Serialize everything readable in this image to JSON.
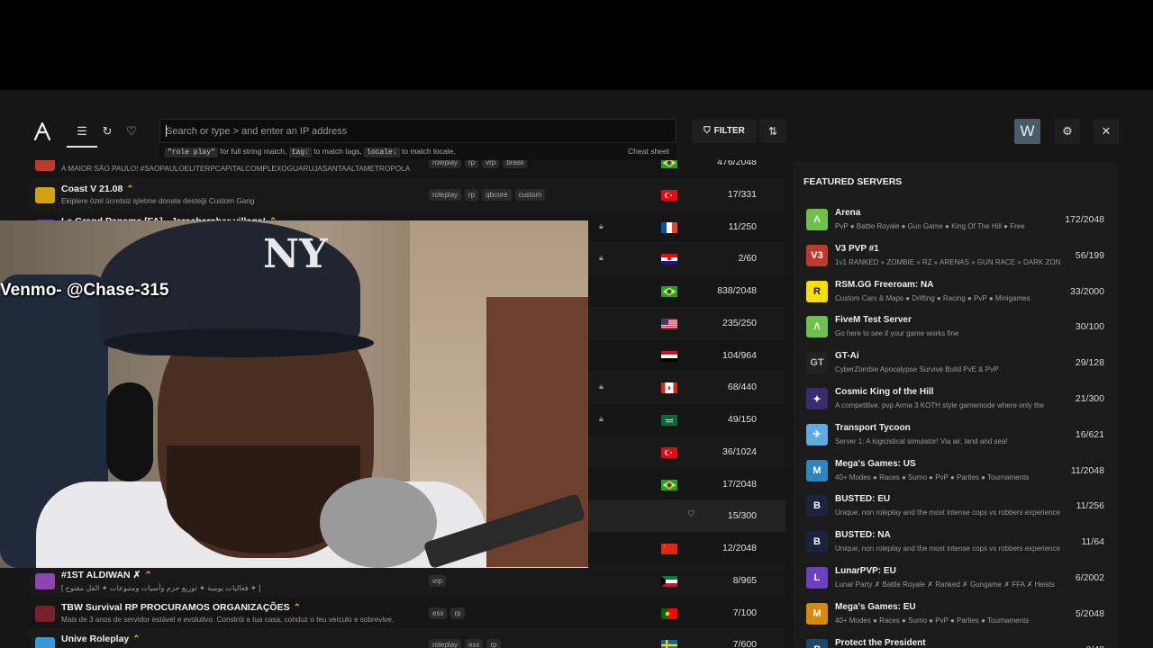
{
  "topbar": {
    "search_placeholder": "Search or type > and enter an IP address",
    "hint_code1": "\"role play\"",
    "hint_text1": " for full string match,",
    "hint_code2": "tag:",
    "hint_text2": " to match tags,",
    "hint_code3": "locale:",
    "hint_text3": " to match locale,",
    "cheat_sheet": "Cheat sheet",
    "filter_label": "FILTER",
    "avatar_initial": "W"
  },
  "servers": [
    {
      "name": "",
      "desc": "A MAIOR SÃO PAULO! #SAOPAULOELITERPCAPITALCOMPLEXOGUARUJASANTAALTAMETROPOLA",
      "tags": [
        "roleplay",
        "rp",
        "vrp",
        "brasil"
      ],
      "players": "476/2048",
      "flag": "br",
      "boost": false,
      "lock": false,
      "icon": "#c0392b"
    },
    {
      "name": "Coast V 21.08",
      "desc": "Ekiplere özel ücretsiz işletme donate desteği Custom Gang",
      "tags": [
        "roleplay",
        "rp",
        "qbcore",
        "custom"
      ],
      "players": "17/331",
      "flag": "tr",
      "boost": true,
      "lock": false,
      "icon": "#d4a017"
    },
    {
      "name": "Le Grand Panama [FA] - Jeracheraber village!",
      "desc": "",
      "tags": [],
      "players": "11/250",
      "flag": "fr",
      "boost": true,
      "lock": true,
      "icon": "#7a2a8c"
    },
    {
      "name": "",
      "desc": "",
      "tags": [],
      "players": "2/60",
      "flag": "hr",
      "boost": false,
      "lock": true,
      "icon": "#333"
    },
    {
      "name": "",
      "desc": "",
      "tags": [],
      "players": "838/2048",
      "flag": "br",
      "boost": false,
      "lock": false,
      "icon": "#333"
    },
    {
      "name": "",
      "desc": "",
      "tags": [],
      "players": "235/250",
      "flag": "us",
      "boost": false,
      "lock": false,
      "icon": "#333"
    },
    {
      "name": "",
      "desc": "",
      "tags": [],
      "players": "104/964",
      "flag": "eg",
      "boost": false,
      "lock": false,
      "icon": "#333"
    },
    {
      "name": "",
      "desc": "",
      "tags": [],
      "players": "68/440",
      "flag": "ca",
      "boost": false,
      "lock": true,
      "icon": "#333"
    },
    {
      "name": "",
      "desc": "",
      "tags": [],
      "players": "49/150",
      "flag": "sa",
      "boost": false,
      "lock": true,
      "icon": "#333"
    },
    {
      "name": "",
      "desc": "",
      "tags": [],
      "players": "36/1024",
      "flag": "tr",
      "boost": false,
      "lock": false,
      "icon": "#333"
    },
    {
      "name": "",
      "desc": "",
      "tags": [],
      "players": "17/2048",
      "flag": "br",
      "boost": false,
      "lock": false,
      "icon": "#333"
    },
    {
      "name": "",
      "desc": "",
      "tags": [],
      "players": "15/300",
      "flag": "",
      "boost": false,
      "lock": false,
      "fav": true,
      "icon": "#333"
    },
    {
      "name": "",
      "desc": "",
      "tags": [],
      "players": "12/2048",
      "flag": "cn",
      "boost": false,
      "lock": false,
      "icon": "#333"
    },
    {
      "name": "#1ST ALDIWAN ✗",
      "desc": "[ فعاليات يومية ✦ توزيع حزم وأسيات ومتبوعات ✦ الفل مفتوح ✦ ]",
      "tags": [
        "vrp"
      ],
      "players": "8/965",
      "flag": "kw",
      "boost": true,
      "lock": false,
      "icon": "#8e44ad"
    },
    {
      "name": "TBW Survival RP PROCURAMOS ORGANIZAÇÕES",
      "desc": "Mais de 3 anos de servidor estável e evolutivo. Constrói a tua casa, conduz o teu veículo e sobrevive.",
      "tags": [
        "esx",
        "rp"
      ],
      "players": "7/100",
      "flag": "pt",
      "boost": true,
      "lock": false,
      "icon": "#7b1f2a"
    },
    {
      "name": "Unive Roleplay",
      "desc": "",
      "tags": [
        "roleplay",
        "esx",
        "rp"
      ],
      "players": "7/600",
      "flag": "se",
      "boost": true,
      "lock": false,
      "icon": "#3498db"
    }
  ],
  "featured": {
    "title": "FEATURED SERVERS",
    "items": [
      {
        "name": "Arena",
        "desc": "PvP ● Battle Royale ● Gun Game ● King Of The Hill ● Free",
        "players": "172/2048",
        "bg": "#6cc24a",
        "fg": "#fff",
        "glyph": "Λ"
      },
      {
        "name": "V3 PVP #1",
        "desc": "1v1 RANKED » ZOMBIE » RZ » ARENAS » GUN RACE » DARK ZONE",
        "players": "56/199",
        "bg": "#c0392b",
        "fg": "#fff",
        "glyph": "V3"
      },
      {
        "name": "RSM.GG Freeroam: NA",
        "desc": "Custom Cars & Maps ● Drifting ● Racing ● PvP ● Minigames",
        "players": "33/2000",
        "bg": "#f5e000",
        "fg": "#111",
        "glyph": "R"
      },
      {
        "name": "FiveM Test Server",
        "desc": "Go here to see if your game works fine",
        "players": "30/100",
        "bg": "#6cc24a",
        "fg": "#fff",
        "glyph": "Λ"
      },
      {
        "name": "GT-Ai",
        "desc": "CyberZombie Apocalypse Survive Build PvE & PvP",
        "players": "29/128",
        "bg": "#222",
        "fg": "#bbb",
        "glyph": "GT"
      },
      {
        "name": "Cosmic King of the Hill",
        "desc": "A competitive, pvp Arma 3 KOTH style gamemode where only the",
        "players": "21/300",
        "bg": "#3b2a6e",
        "fg": "#fff",
        "glyph": "✦"
      },
      {
        "name": "Transport Tycoon",
        "desc": "Server 1: A logicistical simulator! Via air, land and sea!",
        "players": "16/621",
        "bg": "#5dade2",
        "fg": "#fff",
        "glyph": "✈"
      },
      {
        "name": "Mega's Games: US",
        "desc": "40+ Modes ● Races ● Sumo ● PvP ● Parties ● Tournaments",
        "players": "11/2048",
        "bg": "#2e86c1",
        "fg": "#fff",
        "glyph": "M"
      },
      {
        "name": "BUSTED: EU",
        "desc": "Unique, non roleplay and the most intense cops vs robbers experience",
        "players": "11/256",
        "bg": "#1a2340",
        "fg": "#fff",
        "glyph": "B"
      },
      {
        "name": "BUSTED: NA",
        "desc": "Unique, non roleplay and the most intense cops vs robbers experience",
        "players": "11/64",
        "bg": "#1a2340",
        "fg": "#fff",
        "glyph": "B"
      },
      {
        "name": "LunarPVP: EU",
        "desc": "Lunar Party ✗ Battle Royale ✗ Ranked ✗ Gungame ✗ FFA ✗ Heists",
        "players": "6/2002",
        "bg": "#6c3fc4",
        "fg": "#fff",
        "glyph": "L"
      },
      {
        "name": "Mega's Games: EU",
        "desc": "40+ Modes ● Races ● Sumo ● PvP ● Parties ● Tournaments",
        "players": "5/2048",
        "bg": "#d68910",
        "fg": "#fff",
        "glyph": "M"
      },
      {
        "name": "Protect the President",
        "desc": "",
        "players": "0/48",
        "bg": "#1a4a6e",
        "fg": "#fff",
        "glyph": "P"
      }
    ]
  },
  "webcam": {
    "overlay_text": "Venmo- @Chase-315",
    "cap_logo": "NY"
  }
}
